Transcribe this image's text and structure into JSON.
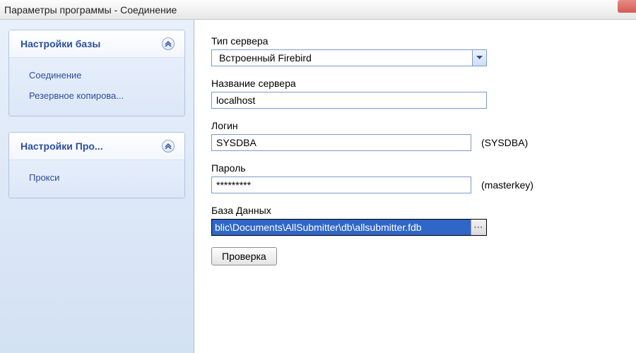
{
  "window": {
    "title": "Параметры программы - Соединение"
  },
  "sidebar": {
    "panels": [
      {
        "title": "Настройки базы",
        "items": [
          {
            "label": "Соединение"
          },
          {
            "label": "Резервное копирова..."
          }
        ]
      },
      {
        "title": "Настройки Про...",
        "items": [
          {
            "label": "Прокси"
          }
        ]
      }
    ]
  },
  "form": {
    "server_type": {
      "label": "Тип сервера",
      "value": "Встроенный Firebird"
    },
    "server_name": {
      "label": "Название сервера",
      "value": "localhost"
    },
    "login": {
      "label": "Логин",
      "value": "SYSDBA",
      "hint": "(SYSDBA)"
    },
    "password": {
      "label": "Пароль",
      "value": "*********",
      "hint": "(masterkey)"
    },
    "database": {
      "label": "База Данных",
      "value": "blic\\Documents\\AllSubmitter\\db\\allsubmitter.fdb",
      "browse": "···"
    },
    "check_button": "Проверка"
  }
}
